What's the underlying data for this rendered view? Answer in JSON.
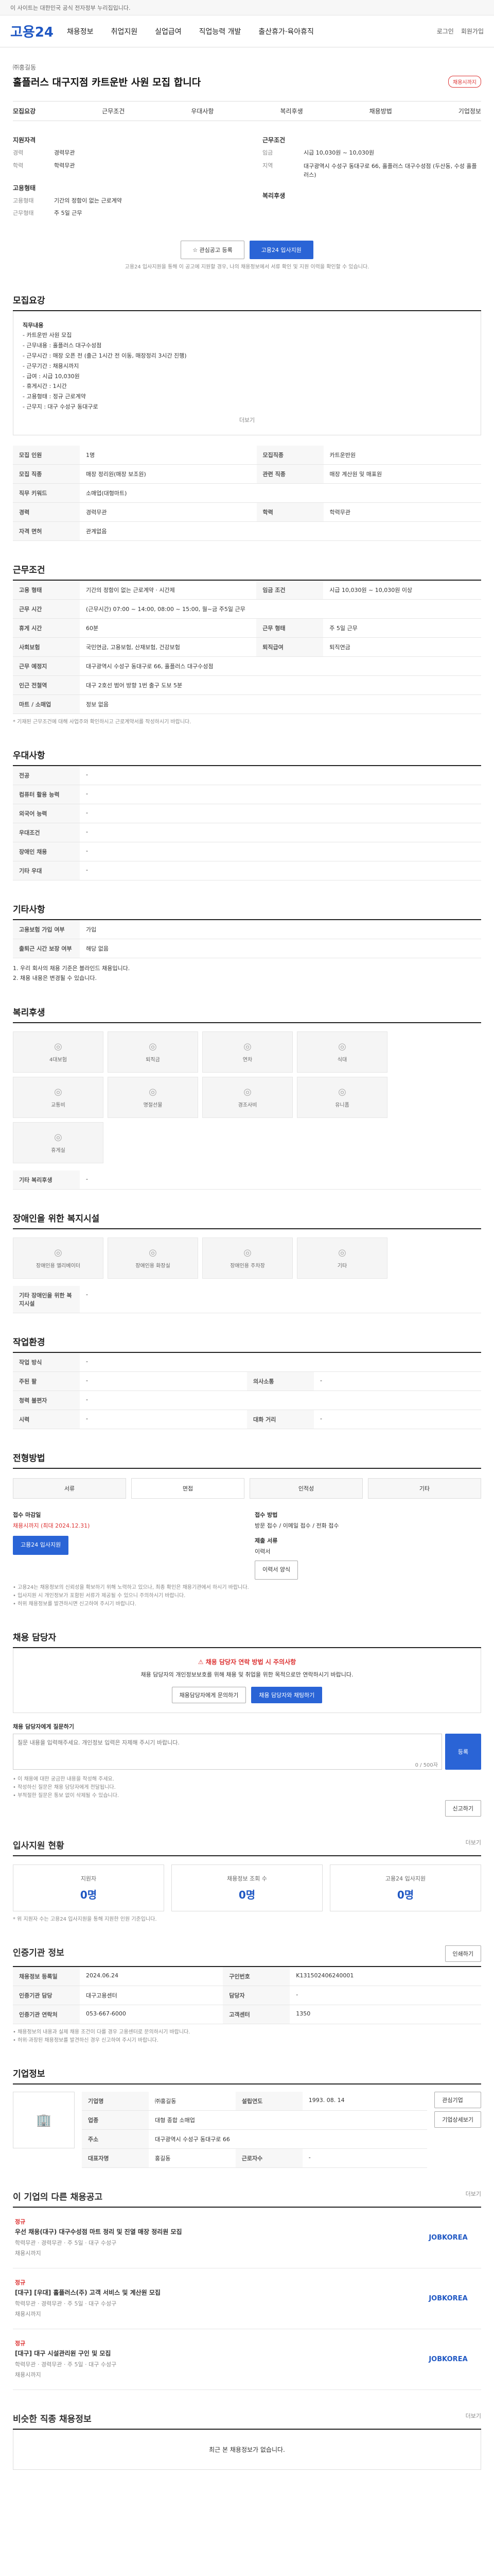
{
  "topbar": {
    "text": "이 사이트는 대한민국 공식 전자정부 누리집입니다."
  },
  "gnb": {
    "logo": "고용24",
    "menu": [
      "채용정보",
      "취업지원",
      "실업급여",
      "직업능력 개발",
      "출산휴가·육아휴직"
    ],
    "right": [
      "로그인",
      "회원가입"
    ]
  },
  "job": {
    "company": "㈜홍길동",
    "title": "홀플러스 대구지점 카트운반 사원 모집 합니다",
    "status_badge": "채용시까지",
    "tabs": [
      "모집요강",
      "근무조건",
      "우대사항",
      "복리후생",
      "채용방법",
      "기업정보"
    ],
    "summary_left": [
      {
        "k": "지원자격",
        "v": ""
      },
      {
        "k": "경력",
        "v": "경력무관"
      },
      {
        "k": "학력",
        "v": "학력무관"
      },
      {
        "k": "고용형태",
        "v": ""
      },
      {
        "k": "고용형태",
        "v": "기간의 정함이 없는 근로계약"
      },
      {
        "k": "근무형태",
        "v": "주 5일 근무"
      }
    ],
    "summary_right": [
      {
        "k": "근무조건",
        "v": ""
      },
      {
        "k": "임금",
        "v": "시급 10,030원 ~ 10,030원"
      },
      {
        "k": "지역",
        "v": "대구광역시 수성구 동대구로 66, 홀플러스 대구수성점 (두산동, 수성 홀플러스)"
      },
      {
        "k": "복리후생",
        "v": ""
      }
    ],
    "buttons": {
      "interest": "관심공고 등록",
      "apply": "고용24 입사지원"
    },
    "apply_note": "고용24 입사지원을 통해 이 공고에 지원할 경우, 나의 채용정보에서 서류 확인 및 지원 이력을 확인할 수 있습니다."
  },
  "recruit": {
    "title": "모집요강",
    "section_label": "직무내용",
    "duties": [
      "- 카트운반 사원 모집",
      "- 근무내용 : 홀플러스 대구수성점",
      "- 근무시간 : 매장 오픈 전 (출근 1시간 전 이동, 매장정리 3시간 진행)",
      "- 근무기간 : 채용시까지",
      "- 급여 : 시급 10,030원",
      "- 휴게시간 : 1시간",
      "- 고용형태 : 정규 근로계약",
      "- 근무지 : 대구 수성구 동대구로"
    ],
    "more": "더보기",
    "rows": [
      {
        "k": "모집 인원",
        "v": "1명",
        "k2": "모집직종",
        "v2": "카트운반원"
      },
      {
        "k": "모집 직종",
        "v": "매장 정리원(매장 보조원)",
        "k2": "관련 직종",
        "v2": "매장 계산원 및 매표원"
      },
      {
        "k": "직무 키워드",
        "v": "소매업(대형마트)",
        "k2": "",
        "v2": ""
      },
      {
        "k": "경력",
        "v": "경력무관",
        "k2": "학력",
        "v2": "학력무관"
      },
      {
        "k": "자격 면허",
        "v": "관계없음",
        "k2": "",
        "v2": ""
      }
    ]
  },
  "condition": {
    "title": "근무조건",
    "rows": [
      {
        "k": "고용 형태",
        "v": "기간의 정함이 없는 근로계약 · 시간제",
        "k2": "임금 조건",
        "v2": "시급 10,030원 ~ 10,030원 이상"
      },
      {
        "k": "근무 시간",
        "v": "(근무시간) 07:00 ~ 14:00, 08:00 ~ 15:00, 월~금 주5일 근무",
        "k2": "",
        "v2": ""
      },
      {
        "k": "휴게 시간",
        "v": "60분",
        "k2": "근무 형태",
        "v2": "주 5일 근무"
      },
      {
        "k": "사회보험",
        "v": "국민연금, 고용보험, 산재보험, 건강보험",
        "k2": "퇴직급여",
        "v2": "퇴직연금"
      },
      {
        "k": "근무 예정지",
        "v": "대구광역시 수성구 동대구로 66, 홀플러스 대구수성점",
        "k2": "",
        "v2": ""
      },
      {
        "k": "인근 전철역",
        "v": "대구 2호선 범어 방향 1번 출구 도보 5분",
        "k2": "",
        "v2": ""
      },
      {
        "k": "마트 / 소매업",
        "v": "정보 없음",
        "k2": "",
        "v2": ""
      }
    ],
    "note": "* 기재된 근무조건에 대해 사업주와 확인하시고 근로계약서를 작성하시기 바랍니다."
  },
  "prefer": {
    "title": "우대사항",
    "rows": [
      {
        "k": "전공",
        "v": "-"
      },
      {
        "k": "컴퓨터 활용 능력",
        "v": "-"
      },
      {
        "k": "외국어 능력",
        "v": "-"
      },
      {
        "k": "우대조건",
        "v": "-"
      },
      {
        "k": "장애인 채용",
        "v": "-"
      },
      {
        "k": "기타 우대",
        "v": "-"
      }
    ]
  },
  "other": {
    "title": "기타사항",
    "rows": [
      {
        "k": "고용보험 가입 여부",
        "v": "가입"
      },
      {
        "k": "출퇴근 시간 보장 여부",
        "v": "해당 없음"
      }
    ],
    "notes": [
      "1. 우리 회사의 채용 기준은 블라인드 채용입니다.",
      "2. 채용 내용은 변경될 수 있습니다."
    ]
  },
  "welfare": {
    "title": "복리후생",
    "icons": [
      "4대보험",
      "퇴직금",
      "연차",
      "식대",
      "교통비",
      "명절선물",
      "경조사비",
      "유니폼",
      "휴게실"
    ],
    "extra_label": "기타 복리후생",
    "extra_value": "-"
  },
  "disabled": {
    "title": "장애인을 위한 복지시설",
    "icons": [
      "장애인용 엘리베이터",
      "장애인용 화장실",
      "장애인용 주차장",
      "기타"
    ],
    "extra_label": "기타 장애인을 위한 복지시설",
    "extra_value": "-"
  },
  "env": {
    "title": "작업환경",
    "rows": [
      {
        "k": "작업 방식",
        "v": "-",
        "k2": "",
        "v2": ""
      },
      {
        "k": "주된 팔",
        "v": "-",
        "k2": "의사소통",
        "v2": "-"
      },
      {
        "k": "청력 불편자",
        "v": "-",
        "k2": "",
        "v2": ""
      },
      {
        "k": "시력",
        "v": "-",
        "k2": "대화 거리",
        "v2": "-"
      }
    ]
  },
  "hire": {
    "title": "전형방법",
    "steps": [
      "서류",
      "면접",
      "인적성",
      "기타"
    ],
    "deadline_label": "접수 마감일",
    "deadline_value": "채용시까지 (최대 2024.12.31)",
    "apply_button": "고용24 입사지원",
    "method_label": "접수 방법",
    "method_value": "방문 접수 / 이메일 접수 / 전화 접수",
    "docs_label": "제출 서류",
    "docs_value": "이력서",
    "doc_button": "이력서 양식",
    "notes": [
      "• 고용24는 채용정보의 신뢰성을 확보하기 위해 노력하고 있으나, 최종 확인은 채용기관에서 하시기 바랍니다.",
      "• 입사지원 시 개인정보가 포함된 서류가 제공될 수 있으니 주의하시기 바랍니다.",
      "• 허위 채용정보를 발견하시면 신고하여 주시기 바랍니다."
    ]
  },
  "qa": {
    "title": "채용 담당자",
    "alert_title": "채용 담당자 연락 방법 시 주의사항",
    "alert_text": "채용 담당자의 개인정보보호를 위해 채용 및 취업을 위한 목적으로만 연락하시기 바랍니다.",
    "btn1": "채용담당자에게 문의하기",
    "btn2": "채용 담당자와 채팅하기",
    "ask_label": "채용 담당자에게 질문하기",
    "ask_placeholder": "질문 내용을 입력해주세요. 개인정보 입력은 자제해 주시기 바랍니다.",
    "counter": "0 / 500자",
    "submit": "등록",
    "notes": [
      "• 이 채용에 대한 궁금한 내용을 작성해 주세요.",
      "• 작성하신 질문은 채용 담당자에게 전달됩니다.",
      "• 부적절한 질문은 통보 없이 삭제될 수 있습니다."
    ],
    "report": "신고하기"
  },
  "stats": {
    "title": "입사지원 현황",
    "more": "더보기",
    "cards": [
      {
        "label": "지원자",
        "value": "0명"
      },
      {
        "label": "채용정보 조회 수",
        "value": "0명"
      },
      {
        "label": "고용24 입사지원",
        "value": "0명"
      }
    ],
    "note": "* 위 지원자 수는 고용24 입사지원을 통해 지원한 인원 기준입니다."
  },
  "info": {
    "title": "인증기관 정보",
    "print": "인쇄하기",
    "rows": [
      {
        "k": "채용정보 등록일",
        "v": "2024.06.24",
        "k2": "구인번호",
        "v2": "K131502406240001"
      },
      {
        "k": "인증기관 담당",
        "v": "대구고용센터",
        "k2": "담당자",
        "v2": "-"
      },
      {
        "k": "인증기관 연락처",
        "v": "053-667-6000",
        "k2": "고객센터",
        "v2": "1350"
      }
    ],
    "notes": [
      "• 채용정보의 내용과 실제 채용 조건이 다를 경우 고용센터로 문의하시기 바랍니다.",
      "• 허위·과장된 채용정보를 발견하신 경우 신고하여 주시기 바랍니다."
    ]
  },
  "company": {
    "title": "기업정보",
    "rows": [
      {
        "k": "기업명",
        "v": "㈜홍길동",
        "k2": "설립연도",
        "v2": "1993. 08. 14"
      },
      {
        "k": "업종",
        "v": "대형 종합 소매업",
        "k2": "",
        "v2": ""
      },
      {
        "k": "주소",
        "v": "대구광역시 수성구 동대구로 66",
        "k2": "",
        "v2": ""
      },
      {
        "k": "대표자명",
        "v": "홍길동",
        "k2": "근로자수",
        "v2": "-"
      }
    ],
    "buttons": [
      "관심기업",
      "기업상세보기"
    ]
  },
  "other_jobs": {
    "title": "이 기업의 다른 채용공고",
    "more": "더보기",
    "items": [
      {
        "tag": "정규",
        "title": "우선 채용(대구) 대구수성점 마트 정리 및 진열 매장 정리원 모집",
        "meta": "학력무관 · 경력무관 · 주 5일 · 대구 수성구",
        "date": "채용시까지",
        "logo": "JOBKOREA"
      },
      {
        "tag": "정규",
        "title": "[대구] [우대] 홀플러스(주) 고객 서비스 및 계산원 모집",
        "meta": "학력무관 · 경력무관 · 주 5일 · 대구 수성구",
        "date": "채용시까지",
        "logo": "JOBKOREA"
      },
      {
        "tag": "정규",
        "title": "[대구] 대구 시설관리원 구인 및 모집",
        "meta": "학력무관 · 경력무관 · 주 5일 · 대구 수성구",
        "date": "채용시까지",
        "logo": "JOBKOREA"
      }
    ]
  },
  "recent": {
    "title": "비슷한 직종 채용정보",
    "more": "더보기",
    "empty": "최근 본 채용정보가 없습니다."
  },
  "colors": {
    "accent": "#2a64d6",
    "brand": "#1f57c3",
    "alert": "#d33333"
  }
}
